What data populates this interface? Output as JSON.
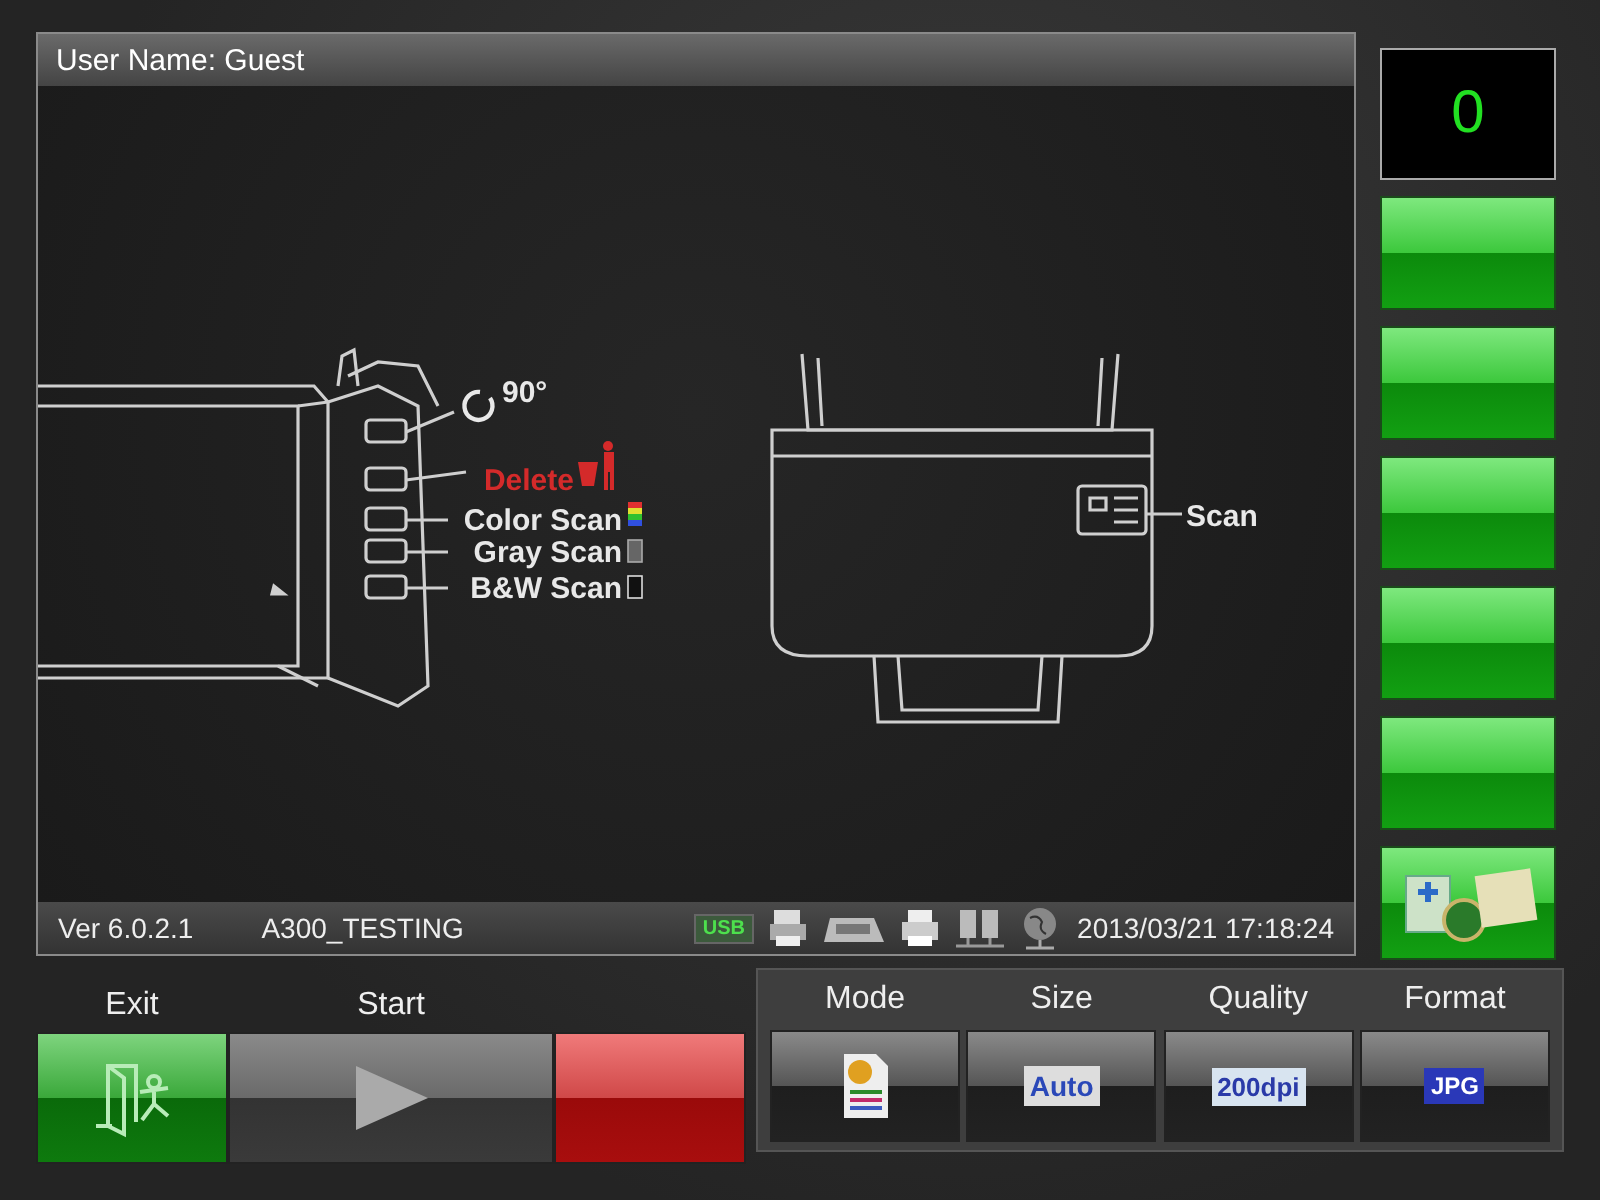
{
  "header": {
    "user_label": "User Name: Guest"
  },
  "diagram": {
    "left_buttons": [
      {
        "label": "90°",
        "kind": "rotate"
      },
      {
        "label": "Delete",
        "kind": "delete"
      },
      {
        "label": "Color Scan",
        "kind": "color"
      },
      {
        "label": "Gray Scan",
        "kind": "gray"
      },
      {
        "label": "B&W Scan",
        "kind": "bw"
      }
    ],
    "right_label": "Scan"
  },
  "status_bar": {
    "version": "Ver 6.0.2.1",
    "device": "A300_TESTING",
    "usb": "USB",
    "datetime": "2013/03/21 17:18:24"
  },
  "counter": "0",
  "side_buttons": [
    {
      "kind": "blank"
    },
    {
      "kind": "blank"
    },
    {
      "kind": "blank"
    },
    {
      "kind": "blank"
    },
    {
      "kind": "blank"
    },
    {
      "kind": "watermark"
    }
  ],
  "actions": [
    {
      "label": "Exit",
      "kind": "exit"
    },
    {
      "label": "Start",
      "kind": "start"
    },
    {
      "kind": "stop"
    }
  ],
  "settings": [
    {
      "label": "Mode",
      "kind": "mode"
    },
    {
      "label": "Size",
      "kind": "size",
      "badge": "Auto"
    },
    {
      "label": "Quality",
      "kind": "quality",
      "badge": "200dpi"
    },
    {
      "label": "Format",
      "kind": "format",
      "badge": "JPG"
    }
  ]
}
